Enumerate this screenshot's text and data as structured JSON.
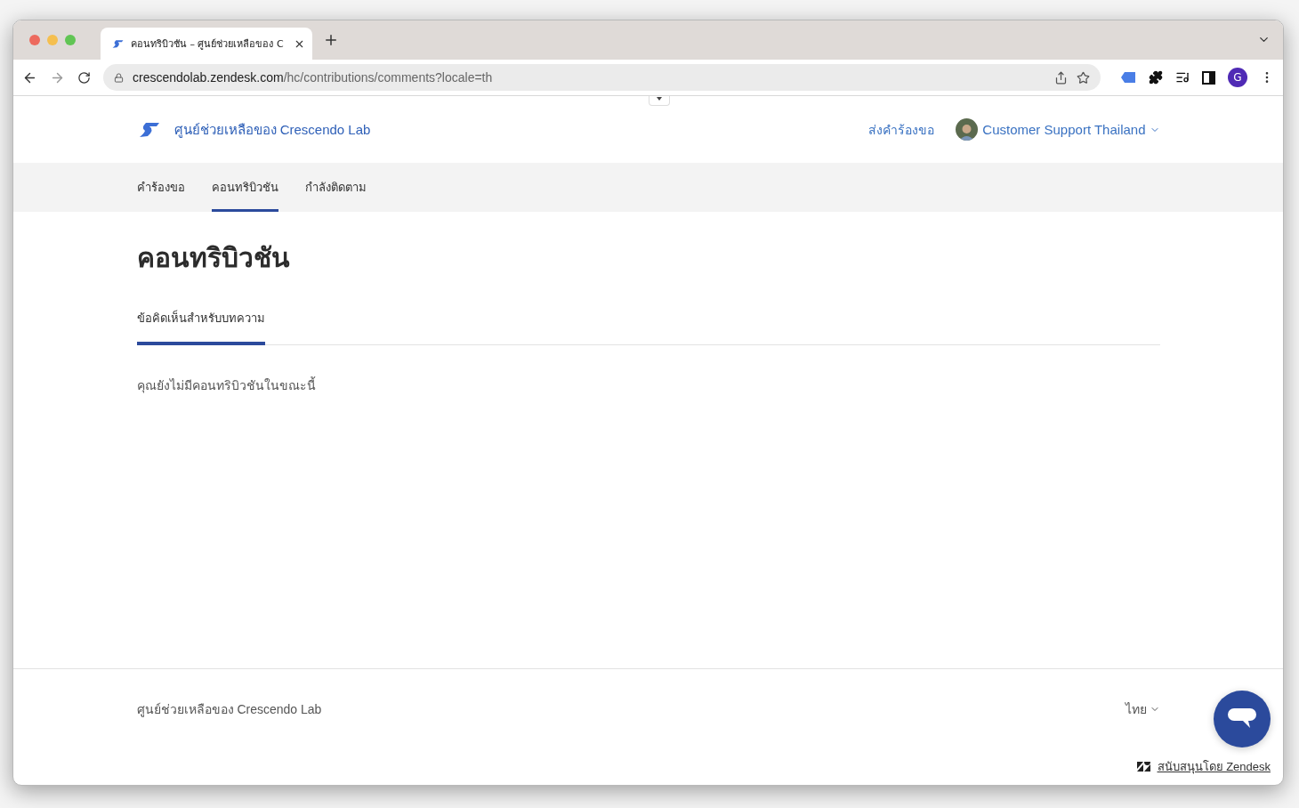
{
  "browser": {
    "tabs": [
      {
        "title": "คอนทริบิวชัน – ศูนย์ช่วยเหลือของ C",
        "selected": true
      }
    ],
    "url_host": "crescendolab.zendesk.com",
    "url_path": "/hc/contributions/comments?locale=th",
    "profile_initial": "G"
  },
  "header": {
    "brand": "ศูนย์ช่วยเหลือของ Crescendo Lab",
    "submit_request": "ส่งคำร้องขอ",
    "user_name": "Customer Support Thailand"
  },
  "nav_tabs": [
    {
      "label": "คำร้องขอ",
      "selected": false
    },
    {
      "label": "คอนทริบิวชัน",
      "selected": true
    },
    {
      "label": "กำลังติดตาม",
      "selected": false
    }
  ],
  "page_title": "คอนทริบิวชัน",
  "sub_tabs": [
    {
      "label": "ข้อคิดเห็นสำหรับบทความ",
      "selected": true
    }
  ],
  "empty_message": "คุณยังไม่มีคอนทริบิวชันในขณะนี้",
  "footer": {
    "brand": "ศูนย์ช่วยเหลือของ Crescendo Lab",
    "language": "ไทย",
    "powered_by": "สนับสนุนโดย Zendesk"
  }
}
